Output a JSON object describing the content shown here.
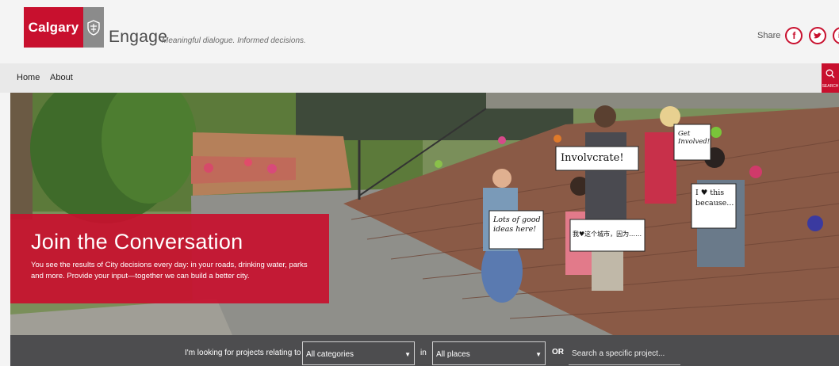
{
  "header": {
    "logo_text": "Calgary",
    "app_title": "Engage",
    "tagline": "Meaningful dialogue. Informed decisions.",
    "share_label": "Share",
    "social": [
      {
        "icon": "facebook-icon",
        "glyph": "f"
      },
      {
        "icon": "twitter-icon",
        "glyph": "t"
      },
      {
        "icon": "linkedin-icon",
        "glyph": "in"
      }
    ]
  },
  "nav": {
    "items": [
      {
        "label": "Home"
      },
      {
        "label": "About"
      }
    ],
    "search_label": "SEARCH"
  },
  "hero": {
    "title": "Join the Conversation",
    "text": "You see the results of City decisions every day: in your roads, drinking water, parks and more. Provide your input—together we can build a better city.",
    "signs": {
      "involvcrate": "Involvcrate!",
      "get_involved": "Get Involved!",
      "lots_of_good": "Lots of good ideas here!",
      "chinese": "我♥这个城市，因为……",
      "i_love": "I ♥ this because..."
    }
  },
  "search": {
    "looking_label": "I'm looking for projects relating to",
    "category_value": "All categories",
    "in_label": "in",
    "place_value": "All places",
    "or_label": "OR",
    "project_placeholder": "Search a specific project..."
  },
  "colors": {
    "brand_red": "#c8102e",
    "search_bar_bg": "#4d4d4f",
    "nav_bg": "#e9e9e9"
  }
}
